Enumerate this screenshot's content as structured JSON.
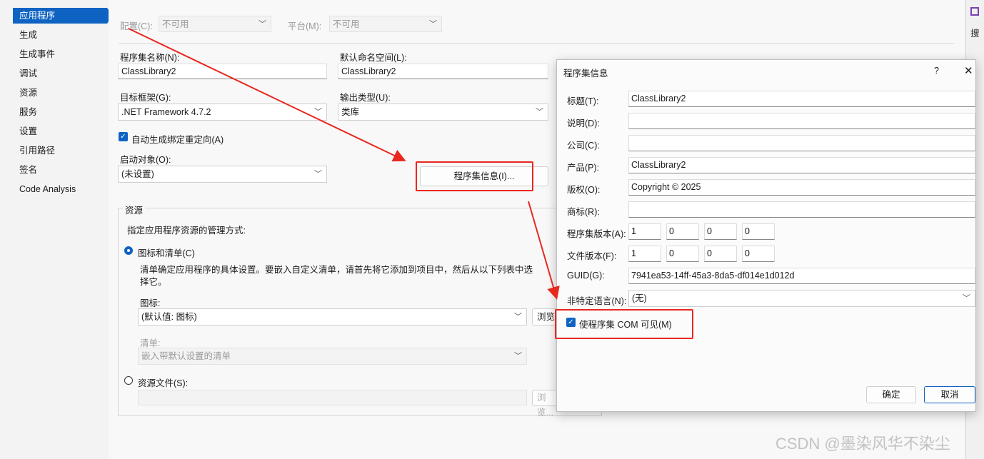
{
  "nav": {
    "items": [
      "应用程序",
      "生成",
      "生成事件",
      "调试",
      "资源",
      "服务",
      "设置",
      "引用路径",
      "签名",
      "Code Analysis"
    ]
  },
  "config": {
    "config_label": "配置(C):",
    "config_value": "不可用",
    "platform_label": "平台(M):",
    "platform_value": "不可用"
  },
  "app": {
    "assembly_name_label": "程序集名称(N):",
    "assembly_name": "ClassLibrary2",
    "default_namespace_label": "默认命名空间(L):",
    "default_namespace": "ClassLibrary2",
    "target_framework_label": "目标框架(G):",
    "target_framework": ".NET Framework 4.7.2",
    "output_type_label": "输出类型(U):",
    "output_type": "类库",
    "auto_binding_label": "自动生成绑定重定向(A)",
    "startup_object_label": "启动对象(O):",
    "startup_object": "(未设置)",
    "assembly_info_button": "程序集信息(I)..."
  },
  "resources": {
    "group_label": "资源",
    "desc": "指定应用程序资源的管理方式:",
    "icon_manifest_radio": "图标和清单(C)",
    "icon_manifest_desc_1": "清单确定应用程序的具体设置。要嵌入自定义清单，请首先将它添加到项目中，然后从以下列表中选",
    "icon_manifest_desc_2": "择它。",
    "icon_label": "图标:",
    "icon_value": "(默认值: 图标)",
    "browse_label": "浏览",
    "manifest_label": "清单:",
    "manifest_value": "嵌入带默认设置的清单",
    "resource_file_radio": "资源文件(S):",
    "browse2_label": "浏览..."
  },
  "dialog": {
    "title": "程序集信息",
    "help": "?",
    "close": "✕",
    "title_label": "标题(T):",
    "title_value": "ClassLibrary2",
    "desc_label": "说明(D):",
    "desc_value": "",
    "company_label": "公司(C):",
    "company_value": "",
    "product_label": "产品(P):",
    "product_value": "ClassLibrary2",
    "copyright_label": "版权(O):",
    "copyright_value": "Copyright ©  2025",
    "trademark_label": "商标(R):",
    "trademark_value": "",
    "assembly_version_label": "程序集版本(A):",
    "assembly_version": [
      "1",
      "0",
      "0",
      "0"
    ],
    "file_version_label": "文件版本(F):",
    "file_version": [
      "1",
      "0",
      "0",
      "0"
    ],
    "guid_label": "GUID(G):",
    "guid_value": "7941ea53-14ff-45a3-8da5-df014e1d012d",
    "neutral_lang_label": "非特定语言(N):",
    "neutral_lang_value": "(无)",
    "com_visible_label": "使程序集 COM 可见(M)",
    "ok": "确定",
    "cancel": "取消"
  },
  "right_strip": {
    "search": "搜"
  },
  "watermark": "CSDN @墨染风华不染尘",
  "colors": {
    "accent": "#0e63c2",
    "annotation_red": "#e8271f"
  }
}
